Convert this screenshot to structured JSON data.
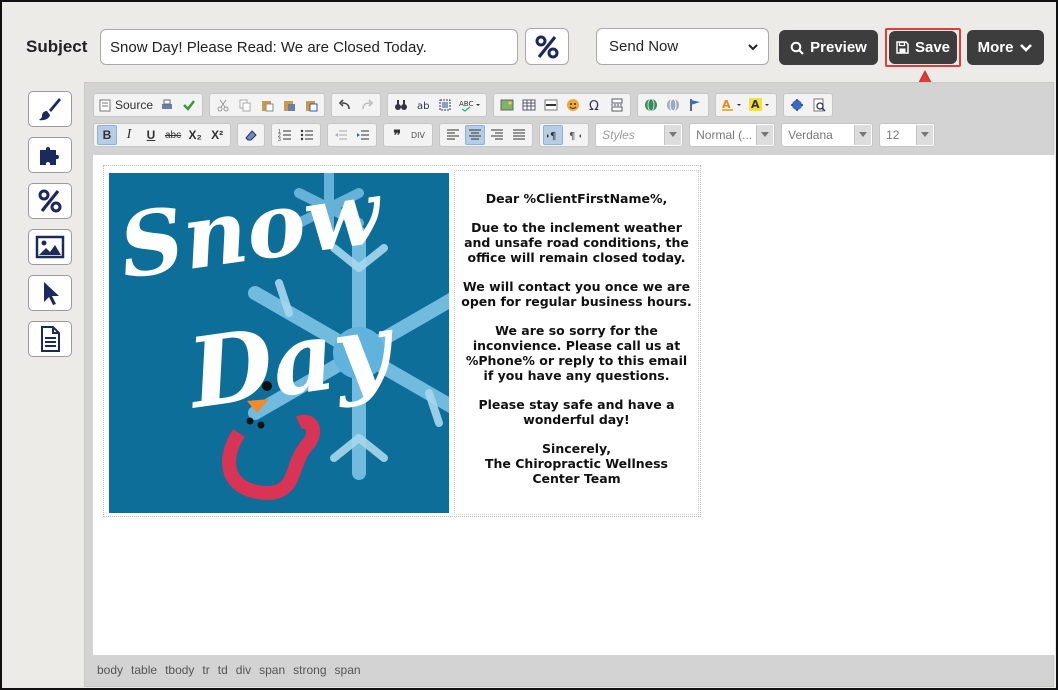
{
  "header": {
    "subject_label": "Subject",
    "subject_value": "Snow Day! Please Read: We are Closed Today.",
    "send_option": "Send Now",
    "preview_label": "Preview",
    "save_label": "Save",
    "more_label": "More"
  },
  "toolbar": {
    "source_label": "Source",
    "styles_placeholder": "Styles",
    "format_value": "Normal (...",
    "font_value": "Verdana",
    "size_value": "12",
    "bold": "B",
    "italic": "I",
    "underline": "U",
    "strike": "abc",
    "subscript": "X₂",
    "superscript": "X²"
  },
  "email": {
    "image_title_1": "Snow",
    "image_title_2": "Day",
    "greeting": "Dear %ClientFirstName%,",
    "para1": "Due to the inclement weather and unsafe road conditions, the office will remain closed today.",
    "para2": "We will contact you once we are open for regular business hours.",
    "para3": "We are so sorry for the inconvience. Please call us at %Phone% or reply to this email if you have any questions.",
    "para4": "Please stay safe and have a wonderful day!",
    "closing": "Sincerely,",
    "signature": "The Chiropractic Wellness Center Team"
  },
  "status_path": [
    "body",
    "table",
    "tbody",
    "tr",
    "td",
    "div",
    "span",
    "strong",
    "span"
  ],
  "colors": {
    "highlight": "#e03a3a",
    "button_dark": "#3d3d3d",
    "image_bg": "#0d6e9a",
    "icon_navy": "#1b2a5e"
  }
}
